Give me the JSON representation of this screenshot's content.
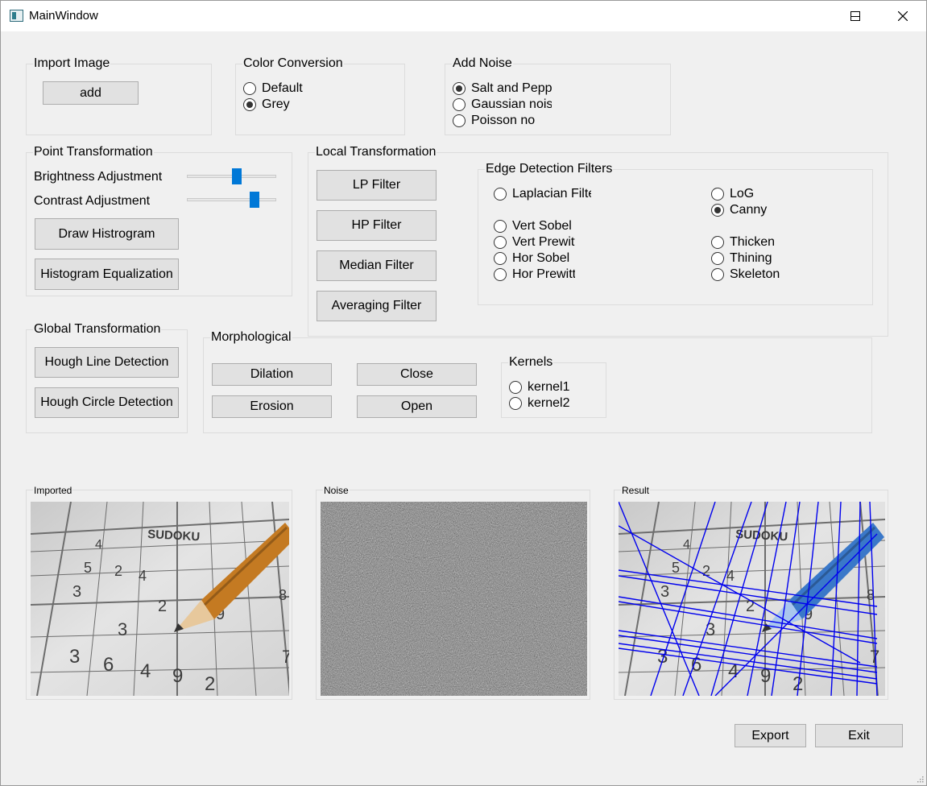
{
  "window": {
    "title": "MainWindow"
  },
  "import": {
    "title": "Import Image",
    "add_label": "add"
  },
  "color": {
    "title": "Color Conversion",
    "options": [
      "Default",
      "Grey"
    ],
    "selected": "Grey"
  },
  "noise": {
    "title": "Add Noise",
    "options": [
      "Salt and Pepper",
      "Gaussian noise",
      "Poisson noise"
    ],
    "selected": "Salt and Pepper"
  },
  "point": {
    "title": "Point Transformation",
    "brightness_label": "Brightness Adjustment",
    "contrast_label": "Contrast Adjustment",
    "brightness_level": 0.56,
    "contrast_level": 0.76,
    "draw_hist_label": "Draw Histrogram",
    "hist_eq_label": "Histogram Equalization"
  },
  "local": {
    "title": "Local Transformation",
    "lp_label": "LP Filter",
    "hp_label": "HP Filter",
    "median_label": "Median Filter",
    "avg_label": "Averaging Filter"
  },
  "edge": {
    "title": "Edge Detection Filters",
    "laplacian": "Laplacian Filter",
    "vert_sobel": "Vert Sobel",
    "vert_prewitt": "Vert Prewitt",
    "hor_sobel": "Hor Sobel",
    "hor_prewitt": "Hor Prewitt",
    "log": "LoG",
    "canny": "Canny",
    "thicken": "Thicken",
    "thining": "Thining",
    "skeleton": "Skeleton",
    "selected": "Canny"
  },
  "global": {
    "title": "Global Transformation",
    "hough_line_label": "Hough Line Detection",
    "hough_circle_label": "Hough Circle Detection"
  },
  "morph": {
    "title": "Morphological",
    "dilation_label": "Dilation",
    "close_label": "Close",
    "erosion_label": "Erosion",
    "open_label": "Open",
    "kernels_title": "Kernels",
    "kernel1": "kernel1",
    "kernel2": "kernel2"
  },
  "panels": {
    "imported": "Imported",
    "noise": "Noise",
    "result": "Result"
  },
  "image_digits": {
    "heading": "SUDOKU",
    "cells": [
      "4",
      "5",
      "2",
      "4",
      "3",
      "2",
      "9",
      "8",
      "3",
      "3",
      "6",
      "4",
      "9",
      "2",
      "7"
    ]
  },
  "footer": {
    "export_label": "Export",
    "exit_label": "Exit"
  },
  "colors": {
    "accent": "#0078d7",
    "window_bg": "#f0f0f0",
    "button_bg": "#e1e1e1",
    "hough_lines": "#0000ee"
  }
}
